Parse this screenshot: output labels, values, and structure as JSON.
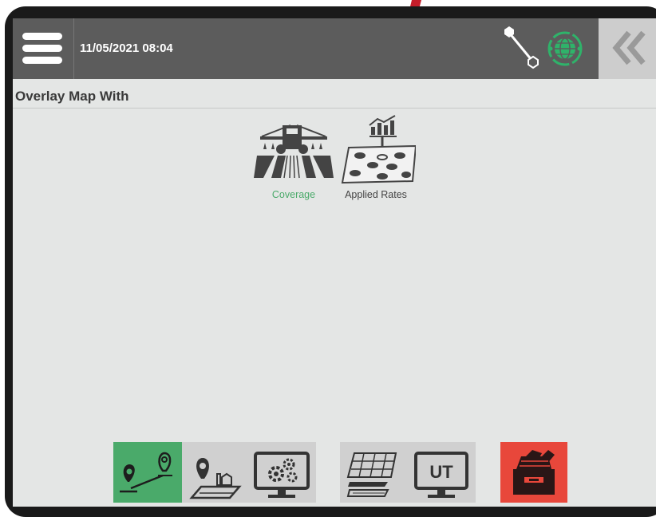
{
  "header": {
    "datetime": "11/05/2021 08:04"
  },
  "page": {
    "title": "Overlay Map With"
  },
  "overlay_options": [
    {
      "label": "Coverage",
      "selected": true,
      "icon": "coverage-sprayer-icon"
    },
    {
      "label": "Applied Rates",
      "selected": false,
      "icon": "applied-rates-icon"
    }
  ],
  "toolbar": {
    "guidance_label": "",
    "ut_label": "UT",
    "buttons": [
      {
        "icon": "guideline-icon",
        "active": true
      },
      {
        "icon": "field-location-icon",
        "active": false
      },
      {
        "icon": "machine-settings-icon",
        "active": false
      },
      {
        "icon": "map-layers-icon",
        "active": false
      },
      {
        "icon": "universal-terminal-icon",
        "active": false
      },
      {
        "icon": "data-management-icon",
        "active": false
      }
    ]
  },
  "colors": {
    "topbar": "#5c5c5c",
    "selected_green": "#4aaa6a",
    "active_button": "#4aaa6a",
    "data_button": "#e8473b",
    "background": "#e4e6e5"
  }
}
